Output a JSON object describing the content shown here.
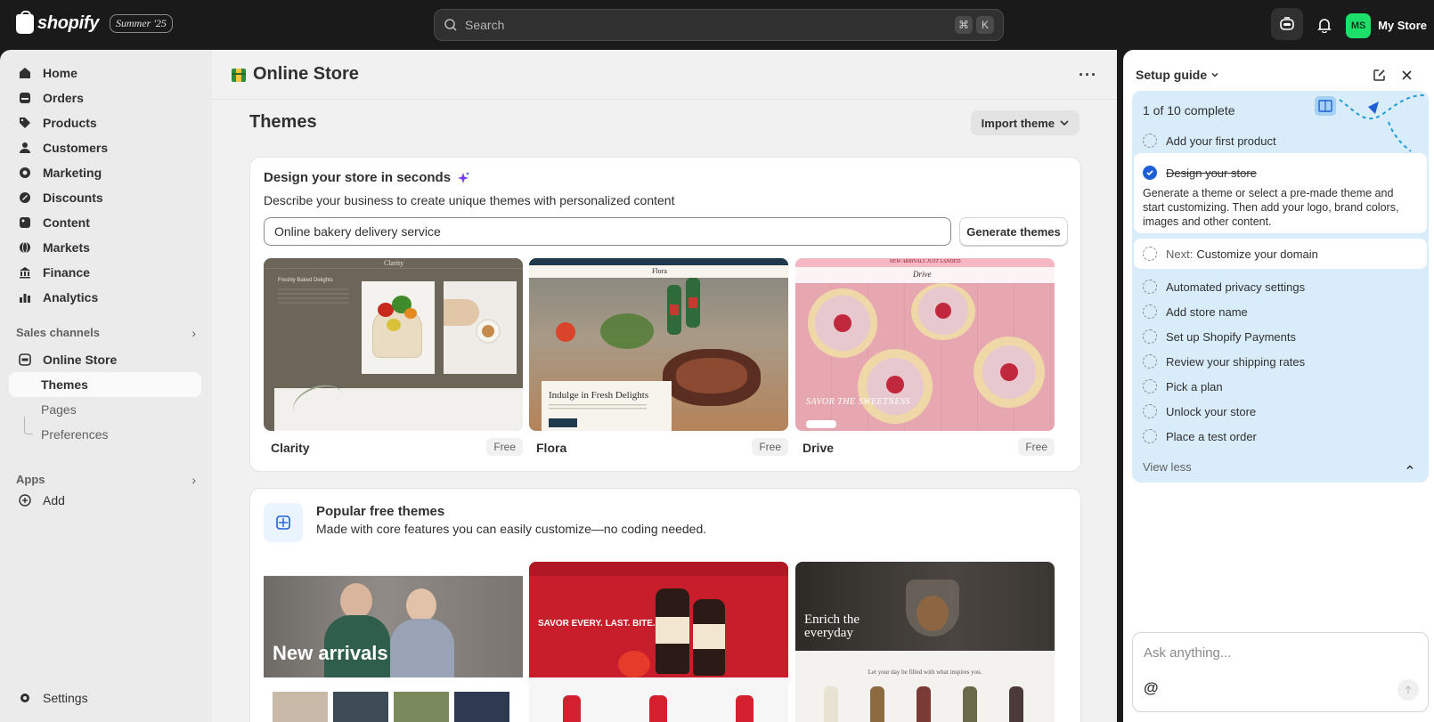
{
  "topbar": {
    "brand": "shopify",
    "edition_badge": "Summer '25",
    "search_placeholder": "Search",
    "shortcut_keys": [
      "⌘",
      "K"
    ],
    "avatar_initials": "MS",
    "store_name": "My Store",
    "avatar_color": "#1de06b"
  },
  "sidebar": {
    "items": [
      {
        "label": "Home",
        "icon": "home-icon"
      },
      {
        "label": "Orders",
        "icon": "orders-icon"
      },
      {
        "label": "Products",
        "icon": "tag-icon"
      },
      {
        "label": "Customers",
        "icon": "person-icon"
      },
      {
        "label": "Marketing",
        "icon": "target-icon"
      },
      {
        "label": "Discounts",
        "icon": "discount-icon"
      },
      {
        "label": "Content",
        "icon": "content-icon"
      },
      {
        "label": "Markets",
        "icon": "globe-icon"
      },
      {
        "label": "Finance",
        "icon": "bank-icon"
      },
      {
        "label": "Analytics",
        "icon": "chart-icon"
      }
    ],
    "sales_channels_label": "Sales channels",
    "online_store_label": "Online Store",
    "sub_items": [
      "Themes",
      "Pages",
      "Preferences"
    ],
    "apps_label": "Apps",
    "add_label": "Add",
    "settings_label": "Settings"
  },
  "main": {
    "page_title": "Online Store",
    "section_title": "Themes",
    "import_button": "Import theme",
    "design_card": {
      "title": "Design your store in seconds",
      "description": "Describe your business to create unique themes with personalized content",
      "input_value": "Online bakery delivery service",
      "generate_button": "Generate themes",
      "themes": [
        {
          "name": "Clarity",
          "price": "Free",
          "preview_heading": "Freshly Baked Delights",
          "preview_brand": "Clarity"
        },
        {
          "name": "Flora",
          "price": "Free",
          "preview_heading": "Indulge in Fresh Delights",
          "preview_brand": "Flora"
        },
        {
          "name": "Drive",
          "price": "Free",
          "preview_heading": "SAVOR THE SWEETNESS",
          "preview_brand": "Drive",
          "preview_banner": "NEW ARRIVALS JUST LANDED"
        }
      ]
    },
    "popular_card": {
      "title": "Popular free themes",
      "description": "Made with core features you can easily customize—no coding needed.",
      "previews": [
        {
          "heading": "New arrivals"
        },
        {
          "heading": "SAVOR EVERY. LAST. BITE."
        },
        {
          "heading": "Enrich the everyday",
          "subtext": "Let your day be filled with what inspires you."
        }
      ]
    }
  },
  "setup_guide": {
    "title": "Setup guide",
    "progress": "1 of 10 complete",
    "steps": [
      {
        "label": "Add your first product",
        "done": false
      },
      {
        "label": "Design your store",
        "done": true
      },
      {
        "label": "Automated privacy settings",
        "done": false
      },
      {
        "label": "Add store name",
        "done": false
      },
      {
        "label": "Set up Shopify Payments",
        "done": false
      },
      {
        "label": "Review your shipping rates",
        "done": false
      },
      {
        "label": "Pick a plan",
        "done": false
      },
      {
        "label": "Unlock your store",
        "done": false
      },
      {
        "label": "Place a test order",
        "done": false
      }
    ],
    "done_step_description": "Generate a theme or select a pre-made theme and start customizing. Then add your logo, brand colors, images and other content.",
    "next_prefix": "Next:",
    "next_step": "Customize your domain",
    "view_less": "View less",
    "ask_placeholder": "Ask anything...",
    "accent_color": "#1f5ed6"
  }
}
